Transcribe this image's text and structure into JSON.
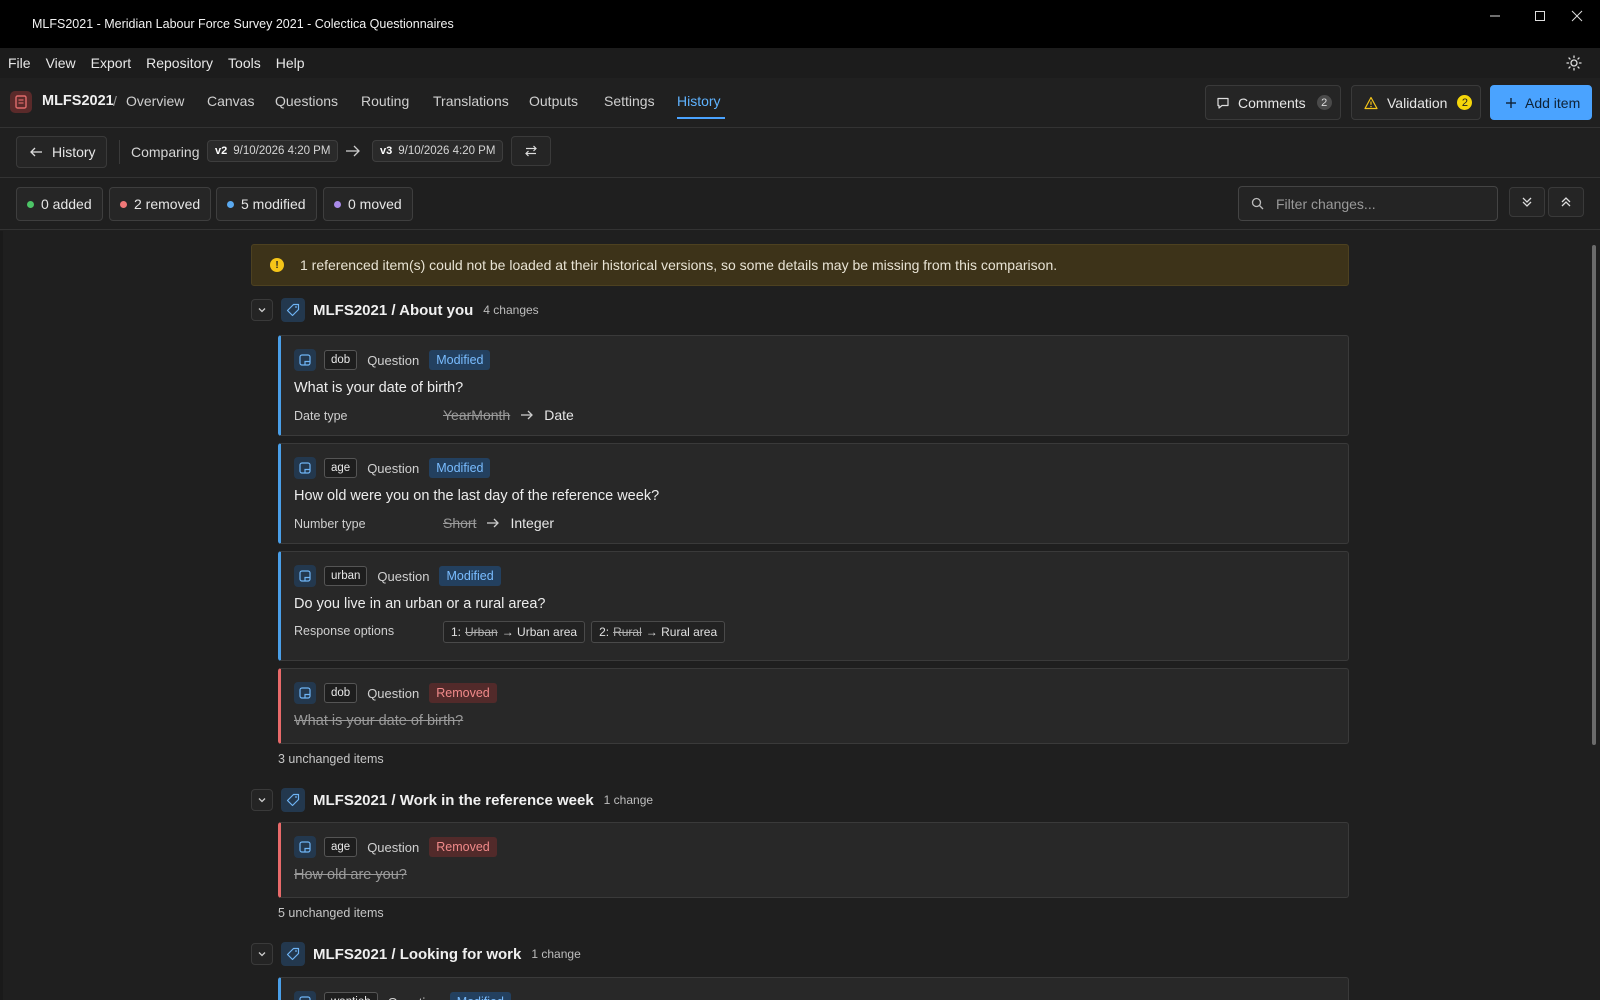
{
  "window": {
    "title": "MLFS2021 - Meridian Labour Force Survey 2021 - Colectica Questionnaires"
  },
  "menu": [
    "File",
    "View",
    "Export",
    "Repository",
    "Tools",
    "Help"
  ],
  "nav": {
    "project": "MLFS2021",
    "separator": "/",
    "tabs": [
      "Overview",
      "Canvas",
      "Questions",
      "Routing",
      "Translations",
      "Outputs",
      "Settings",
      "History"
    ],
    "active_tab": "History",
    "comments_label": "Comments",
    "comments_count": "2",
    "validation_label": "Validation",
    "validation_count": "2",
    "add_item_label": "Add item"
  },
  "compare": {
    "back_label": "History",
    "comparing_label": "Comparing",
    "from_version": "v2",
    "from_date": "9/10/2026 4:20 PM",
    "to_version": "v3",
    "to_date": "9/10/2026 4:20 PM"
  },
  "summary": {
    "added": "0 added",
    "removed": "2 removed",
    "modified": "5 modified",
    "moved": "0 moved",
    "filter_placeholder": "Filter changes..."
  },
  "colors": {
    "added": "#4cc466",
    "removed": "#f07878",
    "modified": "#5aa9f0",
    "moved": "#a98ae8",
    "accent": "#4aa3ff"
  },
  "warning": "1 referenced item(s) could not be loaded at their historical versions, so some details may be missing from this comparison.",
  "groups": [
    {
      "title": "MLFS2021 / About you",
      "changes": "4 changes",
      "unchanged": "3 unchanged items",
      "items": [
        {
          "code": "dob",
          "kind": "Question",
          "status": "Modified",
          "text": "What is your date of birth?",
          "prop": "Date type",
          "old": "YearMonth",
          "new": "Date"
        },
        {
          "code": "age",
          "kind": "Question",
          "status": "Modified",
          "text": "How old were you on the last day of the reference week?",
          "prop": "Number type",
          "old": "Short",
          "new": "Integer"
        },
        {
          "code": "urban",
          "kind": "Question",
          "status": "Modified",
          "text": "Do you live in an urban or a rural area?",
          "prop": "Response options",
          "options": [
            {
              "prefix": "1:",
              "old": "Urban",
              "new": "→ Urban area"
            },
            {
              "prefix": "2:",
              "old": "Rural",
              "new": "→ Rural area"
            }
          ]
        },
        {
          "code": "dob",
          "kind": "Question",
          "status": "Removed",
          "text": "What is your date of birth?"
        }
      ]
    },
    {
      "title": "MLFS2021 / Work in the reference week",
      "changes": "1 change",
      "unchanged": "5 unchanged items",
      "items": [
        {
          "code": "age",
          "kind": "Question",
          "status": "Removed",
          "text": "How old are you?"
        }
      ]
    },
    {
      "title": "MLFS2021 / Looking for work",
      "changes": "1 change",
      "items": [
        {
          "code": "wantjob",
          "kind": "Question",
          "status": "Modified"
        }
      ]
    }
  ]
}
